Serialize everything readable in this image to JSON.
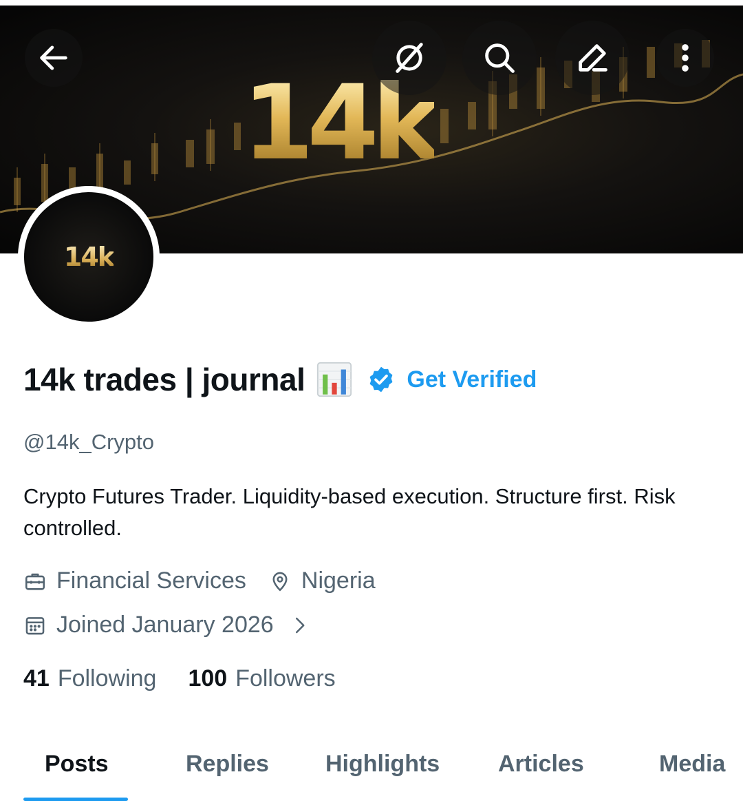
{
  "banner": {
    "logo_text": "14k"
  },
  "header_buttons": {
    "back": "back-arrow-icon",
    "grok": "grok-icon",
    "search": "search-icon",
    "edit": "edit-icon",
    "more": "more-vertical-icon"
  },
  "avatar": {
    "text": "14k"
  },
  "profile": {
    "name": "14k trades | journal",
    "name_emoji": "bar-chart-emoji",
    "get_verified": "Get Verified",
    "handle": "@14k_Crypto",
    "bio": "Crypto Futures Trader. Liquidity-based execution. Structure first. Risk controlled.",
    "category": "Financial Services",
    "location": "Nigeria",
    "joined": "Joined January 2026",
    "following_count": "41",
    "following_label": "Following",
    "followers_count": "100",
    "followers_label": "Followers"
  },
  "tabs": [
    {
      "label": "Posts",
      "active": true
    },
    {
      "label": "Replies",
      "active": false
    },
    {
      "label": "Highlights",
      "active": false
    },
    {
      "label": "Articles",
      "active": false
    },
    {
      "label": "Media",
      "active": false
    }
  ],
  "colors": {
    "accent": "#1d9bf0",
    "text_primary": "#0f1419",
    "text_secondary": "#536471",
    "gold": "#d9b15a"
  }
}
